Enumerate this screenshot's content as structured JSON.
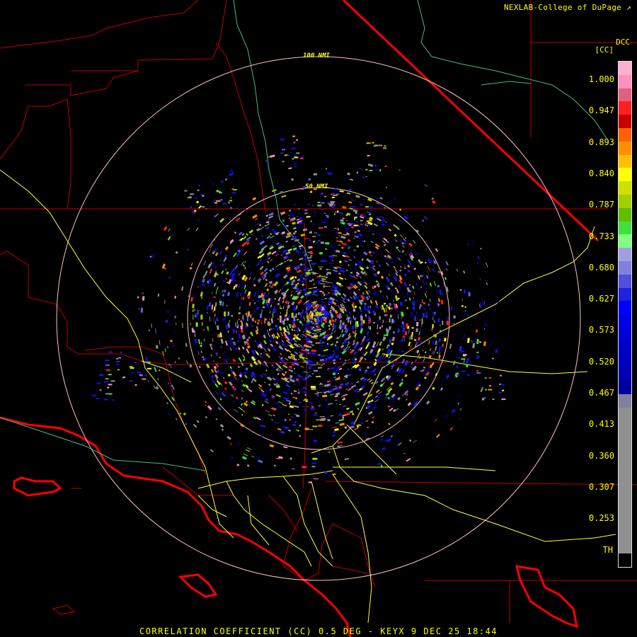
{
  "header": {
    "credit": "NEXLAB-College of DuPage",
    "credit_icon": "external-link-icon",
    "site_code": "DCC",
    "product_code": "[CC]"
  },
  "footer": {
    "title": "CORRELATION COEFFICIENT (CC) 0.5 DEG - KEYX 9 DEC 25 18:44"
  },
  "range_rings": [
    {
      "label": "100 NMI"
    },
    {
      "label": "50 NMI"
    }
  ],
  "legend": {
    "ticks": [
      "1.000",
      "0.947",
      "0.893",
      "0.840",
      "0.787",
      "0.733",
      "0.680",
      "0.627",
      "0.573",
      "0.520",
      "0.467",
      "0.413",
      "0.360",
      "0.307",
      "0.253",
      "TH"
    ],
    "colors": [
      "#ffb0d0",
      "#ff90c0",
      "#e06080",
      "#ff2020",
      "#c80000",
      "#ff6000",
      "#ff9000",
      "#ffc000",
      "#ffff00",
      "#d0e000",
      "#a0d000",
      "#60c000",
      "#40e040",
      "#80ff80",
      "#a0a0e0",
      "#8080e0",
      "#5050e0",
      "#2020e0",
      "#0000ff",
      "#0000e8",
      "#0000d8",
      "#0000c8",
      "#0000c0",
      "#0000b0",
      "#0000a0",
      "#8080a0",
      "#909090",
      "#909090",
      "#909090",
      "#909090",
      "#909090",
      "#909090",
      "#909090",
      "#909090",
      "#909090",
      "#909090",
      "#909090",
      "#000000"
    ]
  },
  "map_colors": {
    "county": "#c00000",
    "state": "#ff0000",
    "coast": "#ff0000",
    "highway": "#ffff40",
    "ring": "#ffc0c0",
    "terrain": "#40c080"
  }
}
